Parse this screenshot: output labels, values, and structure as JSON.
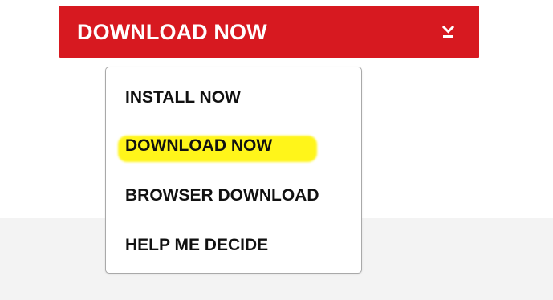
{
  "download_button": {
    "label": "DOWNLOAD NOW",
    "icon": "download-chevron-icon",
    "color": "#d71920"
  },
  "dropdown": {
    "items": [
      {
        "label": "INSTALL NOW"
      },
      {
        "label": "DOWNLOAD NOW",
        "highlighted": true,
        "highlight_color": "#fff51a"
      },
      {
        "label": "BROWSER DOWNLOAD"
      },
      {
        "label": "HELP ME DECIDE"
      }
    ]
  }
}
